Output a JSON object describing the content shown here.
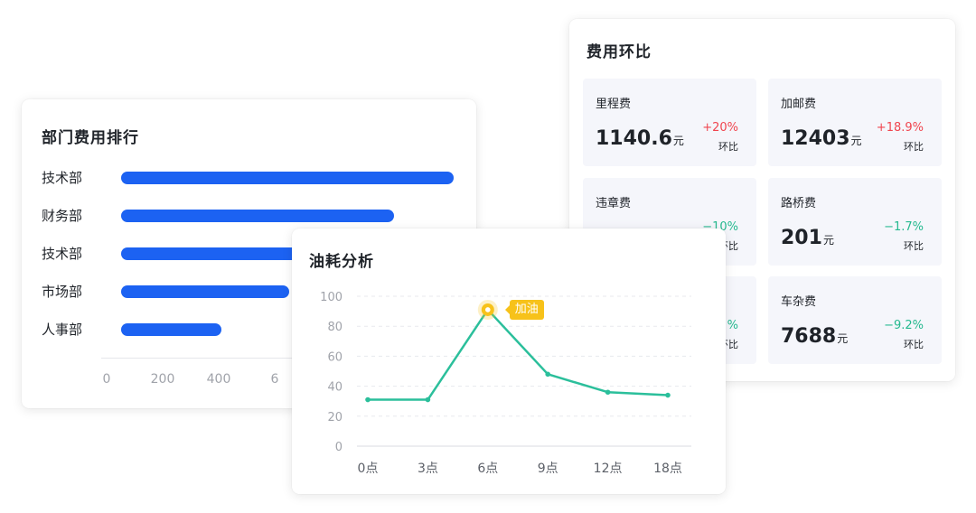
{
  "dept_card": {
    "title": "部门费用排行",
    "axis_ticks": [
      "0",
      "200",
      "400",
      "6"
    ],
    "items": [
      {
        "label": "技术部",
        "value": 920
      },
      {
        "label": "财务部",
        "value": 755
      },
      {
        "label": "技术部",
        "value": 730
      },
      {
        "label": "市场部",
        "value": 465
      },
      {
        "label": "人事部",
        "value": 278
      }
    ],
    "bar_color": "#1c62f2"
  },
  "mom_card": {
    "title": "费用环比",
    "tiles": [
      {
        "name": "里程费",
        "value": "1140.6",
        "unit": "元",
        "pct": "+20%",
        "trend": "up",
        "mom": "环比"
      },
      {
        "name": "加邮费",
        "value": "12403",
        "unit": "元",
        "pct": "+18.9%",
        "trend": "up",
        "mom": "环比"
      },
      {
        "name": "违章费",
        "value": "",
        "unit": "",
        "pct": "−10%",
        "trend": "down",
        "mom": "环比"
      },
      {
        "name": "路桥费",
        "value": "201",
        "unit": "元",
        "pct": "−1.7%",
        "trend": "down",
        "mom": "环比"
      },
      {
        "name": "",
        "value": "",
        "unit": "",
        "pct": "%",
        "trend": "down",
        "mom": "环比"
      },
      {
        "name": "车杂费",
        "value": "7688",
        "unit": "元",
        "pct": "−9.2%",
        "trend": "down",
        "mom": "环比"
      }
    ],
    "up_color": "#f0454f",
    "down_color": "#25b98f"
  },
  "fuel_card": {
    "title": "油耗分析",
    "flag_label": "加油"
  },
  "chart_data": {
    "type": "line",
    "title": "油耗分析",
    "categories": [
      "0点",
      "3点",
      "6点",
      "9点",
      "12点",
      "18点"
    ],
    "values": [
      31,
      31,
      91,
      48,
      36,
      34
    ],
    "y_ticks": [
      "0",
      "20",
      "40",
      "60",
      "80",
      "100"
    ],
    "ylim": [
      0,
      100
    ],
    "grid": true,
    "line_color": "#2bbf9b",
    "annotation": {
      "index": 2,
      "text": "加油",
      "color": "#f7c21a"
    }
  }
}
